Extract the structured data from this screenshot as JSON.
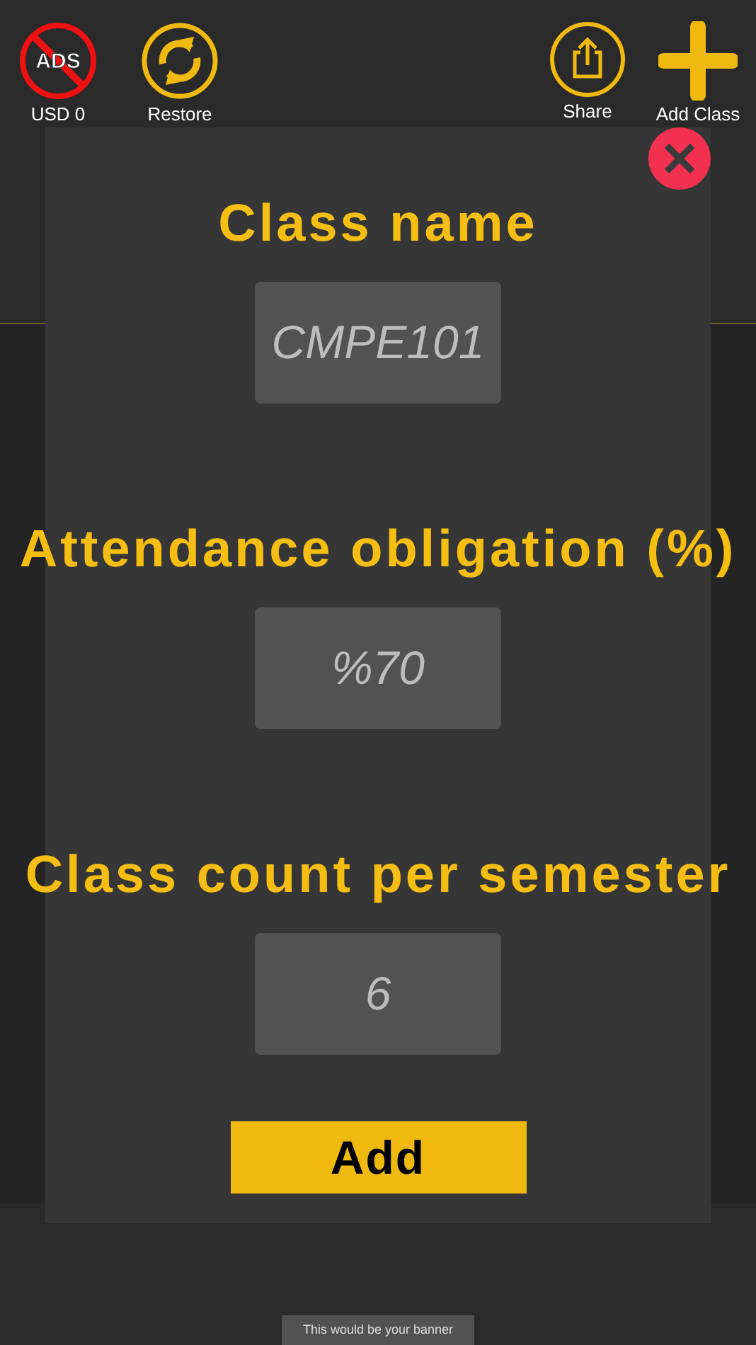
{
  "toolbar": [
    {
      "kind": "noads",
      "icon_text": "ADS",
      "label": "USD 0"
    },
    {
      "kind": "restore",
      "label": "Restore"
    },
    {
      "kind": "share",
      "label": "Share"
    },
    {
      "kind": "add",
      "label": "Add Class"
    }
  ],
  "dialog": {
    "fields": [
      {
        "label": "Class name",
        "placeholder": "CMPE101"
      },
      {
        "label": "Attendance obligation (%)",
        "placeholder": "%70"
      },
      {
        "label": "Class count per semester",
        "placeholder": "6"
      }
    ],
    "submit": "Add"
  },
  "banner": "This would be your banner"
}
